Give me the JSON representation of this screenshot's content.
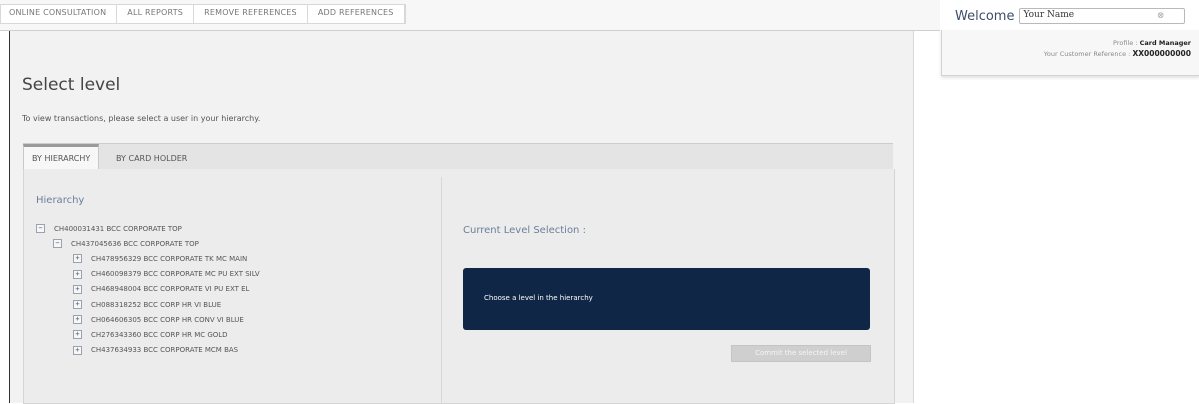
{
  "nav": {
    "items": [
      "ONLINE CONSULTATION",
      "ALL REPORTS",
      "REMOVE REFERENCES",
      "ADD REFERENCES"
    ]
  },
  "header": {
    "welcome": "Welcome",
    "name_value": "Your Name",
    "profile_label": "Profile :",
    "profile_value": "Card Manager",
    "customer_ref_label": "Your Customer Reference :",
    "customer_ref_value": "XX000000000"
  },
  "page": {
    "title": "Select level",
    "instruction": "To view transactions, please select a user in your hierarchy."
  },
  "tabs": [
    "BY HIERARCHY",
    "BY CARD HOLDER"
  ],
  "hierarchy": {
    "title": "Hierarchy",
    "nodes": [
      {
        "label": "CH400031431 BCC CORPORATE TOP",
        "toggle": "−",
        "level": 0
      },
      {
        "label": "CH437045636 BCC CORPORATE TOP",
        "toggle": "−",
        "level": 1
      },
      {
        "label": "CH478956329 BCC CORPORATE TK MC MAIN",
        "toggle": "+",
        "level": 2
      },
      {
        "label": "CH460098379 BCC CORPORATE MC PU EXT SILV",
        "toggle": "+",
        "level": 2
      },
      {
        "label": "CH468948004 BCC CORPORATE VI PU EXT EL",
        "toggle": "+",
        "level": 2
      },
      {
        "label": "CH088318252 BCC CORP HR VI BLUE",
        "toggle": "+",
        "level": 2
      },
      {
        "label": "CH064606305 BCC CORP HR CONV VI BLUE",
        "toggle": "+",
        "level": 2
      },
      {
        "label": "CH276343360 BCC CORP HR MC GOLD",
        "toggle": "+",
        "level": 2
      },
      {
        "label": "CH437634933 BCC CORPORATE MCM BAS",
        "toggle": "+",
        "level": 2
      }
    ]
  },
  "selection": {
    "title": "Current Level Selection :",
    "placeholder": "Choose a level in the hierarchy",
    "commit_button": "Commit the selected level"
  }
}
